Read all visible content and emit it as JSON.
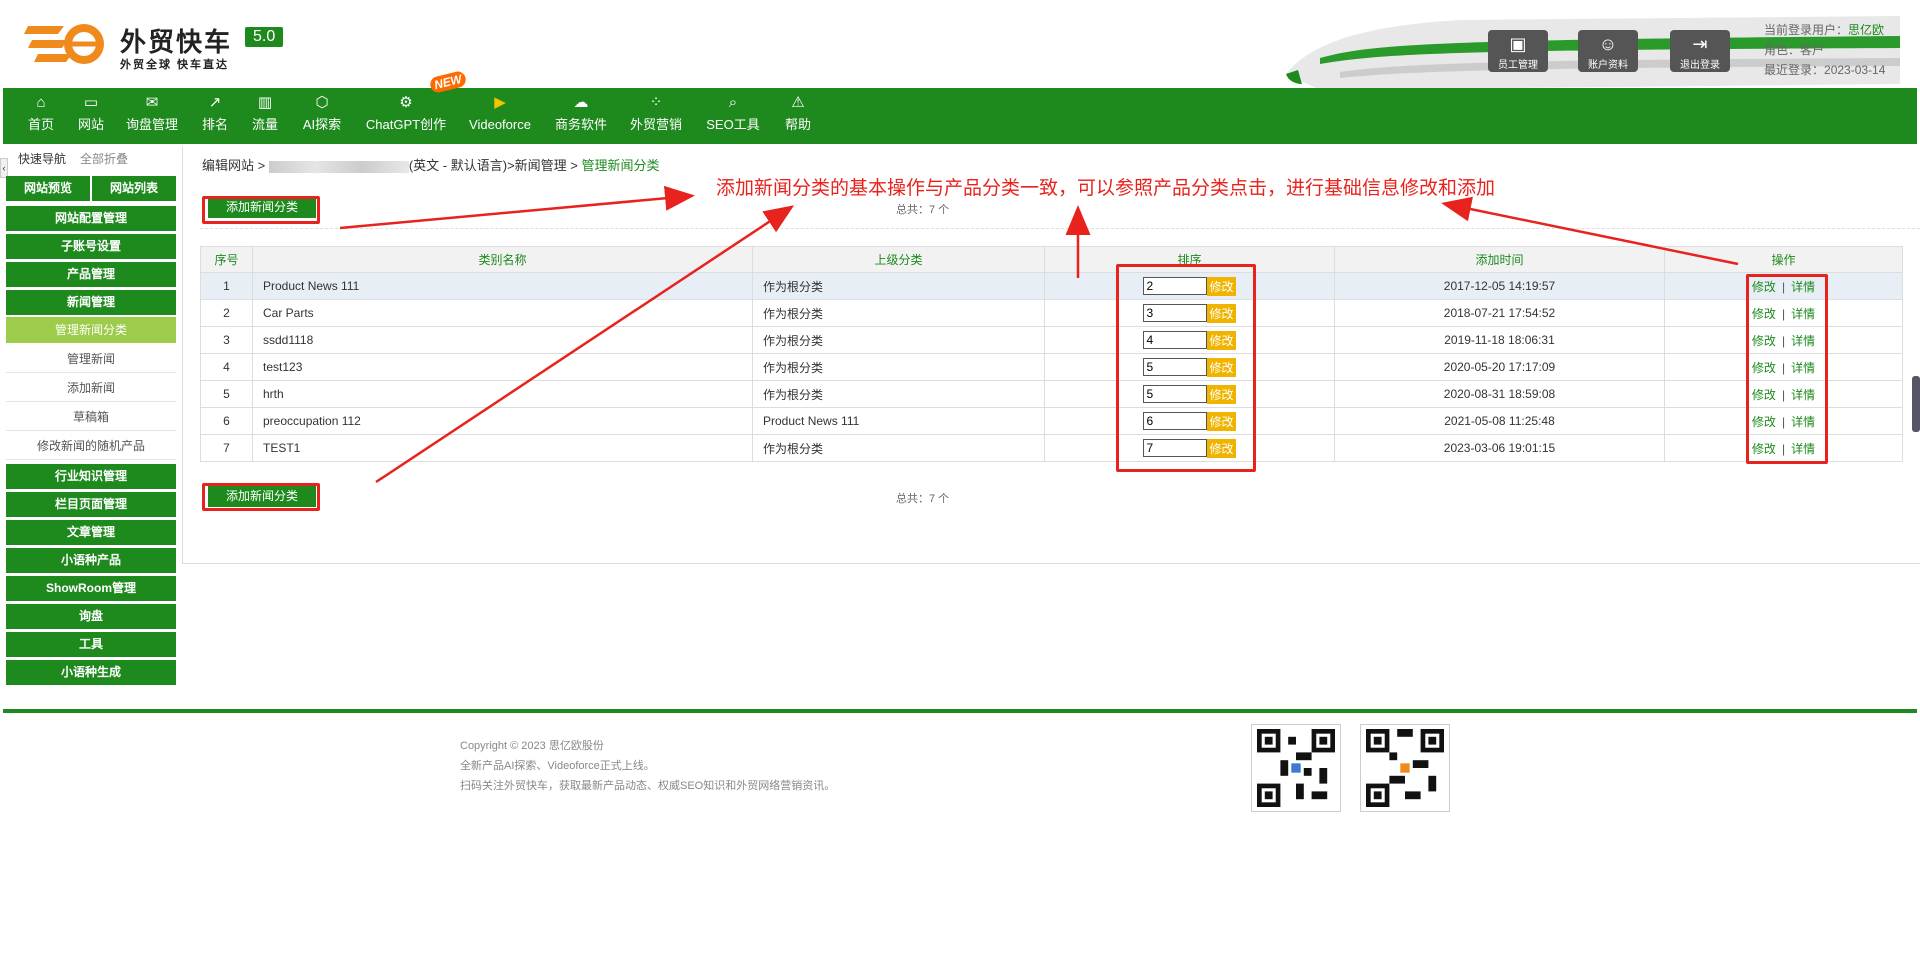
{
  "header": {
    "brand": "外贸快车",
    "version": "5.0",
    "slogan": "外贸全球 快车直达",
    "buttons": [
      {
        "label": "员工管理",
        "icon": "staff-icon"
      },
      {
        "label": "账户资料",
        "icon": "account-icon"
      },
      {
        "label": "退出登录",
        "icon": "logout-icon"
      }
    ],
    "user": {
      "label": "当前登录用户：",
      "name": "思亿欧",
      "role_label": "角色：",
      "role": "客户",
      "last_login_label": "最近登录：",
      "last_login": "2023-03-14"
    }
  },
  "nav": {
    "new_badge": "NEW",
    "items": [
      {
        "label": "首页",
        "icon": "home-icon"
      },
      {
        "label": "网站",
        "icon": "monitor-icon"
      },
      {
        "label": "询盘管理",
        "icon": "mail-icon"
      },
      {
        "label": "排名",
        "icon": "ranking-icon"
      },
      {
        "label": "流量",
        "icon": "bar-chart-icon"
      },
      {
        "label": "AI探索",
        "icon": "ai-icon"
      },
      {
        "label": "ChatGPT创作",
        "icon": "chatgpt-icon"
      },
      {
        "label": "Videoforce",
        "icon": "video-icon"
      },
      {
        "label": "商务软件",
        "icon": "software-icon"
      },
      {
        "label": "外贸营销",
        "icon": "marketing-icon"
      },
      {
        "label": "SEO工具",
        "icon": "search-icon"
      },
      {
        "label": "帮助",
        "icon": "help-icon"
      }
    ]
  },
  "sidebar": {
    "quick_nav": "快速导航",
    "fold_all": "全部折叠",
    "preview": "网站预览",
    "site_list": "网站列表",
    "groups": [
      "网站配置管理",
      "子账号设置",
      "产品管理",
      "新闻管理"
    ],
    "news_sub": [
      "管理新闻分类",
      "管理新闻",
      "添加新闻",
      "草稿箱",
      "修改新闻的随机产品"
    ],
    "groups2": [
      "行业知识管理",
      "栏目页面管理",
      "文章管理",
      "小语种产品",
      "ShowRoom管理",
      "询盘",
      "工具",
      "小语种生成"
    ]
  },
  "breadcrumb": {
    "prefix": "编辑网站 >",
    "lang": "(英文 - 默认语言)",
    "middle": ">新闻管理 >",
    "current": "管理新闻分类"
  },
  "main": {
    "add_button": "添加新闻分类",
    "total": "总共：7 个",
    "annotation": "添加新闻分类的基本操作与产品分类一致，可以参照产品分类点击，进行基础信息修改和添加",
    "columns": [
      "序号",
      "类别名称",
      "上级分类",
      "排序",
      "添加时间",
      "操作"
    ],
    "edit_label": "修改",
    "detail_label": "详情",
    "sort_button": "修改",
    "rows": [
      {
        "no": "1",
        "name": "Product News 111",
        "parent": "作为根分类",
        "sort": "2",
        "time": "2017-12-05 14:19:57"
      },
      {
        "no": "2",
        "name": "Car Parts",
        "parent": "作为根分类",
        "sort": "3",
        "time": "2018-07-21 17:54:52"
      },
      {
        "no": "3",
        "name": "ssdd1118",
        "parent": "作为根分类",
        "sort": "4",
        "time": "2019-11-18 18:06:31"
      },
      {
        "no": "4",
        "name": "test123",
        "parent": "作为根分类",
        "sort": "5",
        "time": "2020-05-20 17:17:09"
      },
      {
        "no": "5",
        "name": "hrth",
        "parent": "作为根分类",
        "sort": "5",
        "time": "2020-08-31 18:59:08"
      },
      {
        "no": "6",
        "name": "preoccupation 112",
        "parent": "Product News 111",
        "sort": "6",
        "time": "2021-05-08 11:25:48"
      },
      {
        "no": "7",
        "name": "TEST1",
        "parent": "作为根分类",
        "sort": "7",
        "time": "2023-03-06 19:01:15"
      }
    ]
  },
  "footer": {
    "copyright": "Copyright © 2023 思亿欧股份",
    "line2": "全新产品AI探索、Videoforce正式上线。",
    "line3": "扫码关注外贸快车，获取最新产品动态、权威SEO知识和外贸网络营销资讯。"
  },
  "colors": {
    "brand_green": "#1e8a1e",
    "active_green": "#9ccc4a",
    "annotation_red": "#e8231e",
    "logo_orange": "#f08a1c"
  }
}
